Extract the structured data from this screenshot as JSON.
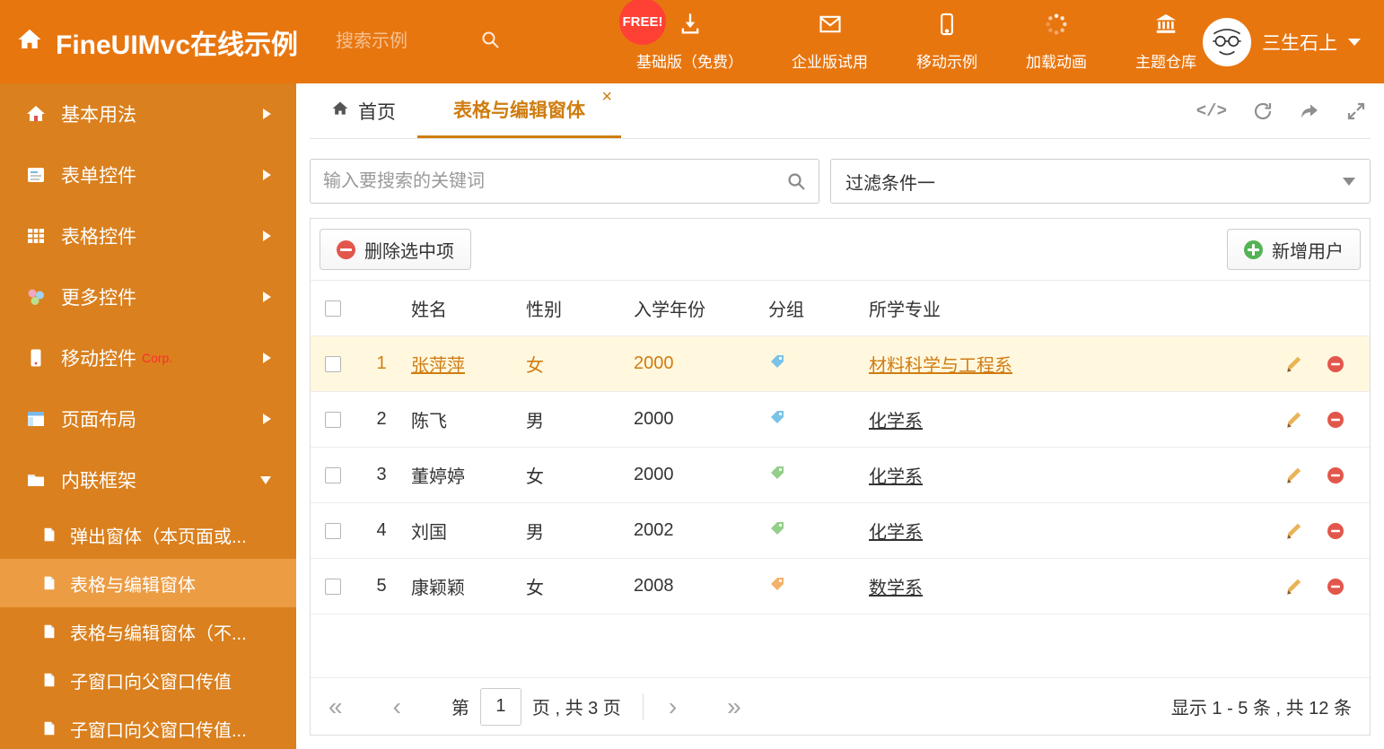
{
  "colors": {
    "header_bg": "#e8760f",
    "sidebar_bg": "#da801e",
    "sidebar_active_bg": "#ec9c43",
    "accent": "#cf7d10",
    "selected_row_bg": "#fff8df",
    "selected_row_text": "#d07c12",
    "delete_red": "#e2574c",
    "add_green": "#54b354",
    "free_badge_red": "#ff4135"
  },
  "header": {
    "title": "FineUIMvc在线示例",
    "search_placeholder": "搜索示例",
    "free_badge": "FREE!",
    "nav": [
      {
        "label": "基础版（免费）",
        "icon": "download-icon"
      },
      {
        "label": "企业版试用",
        "icon": "mail-icon"
      },
      {
        "label": "移动示例",
        "icon": "mobile-icon"
      },
      {
        "label": "加载动画",
        "icon": "spinner-icon"
      },
      {
        "label": "主题仓库",
        "icon": "bank-icon"
      }
    ],
    "user_name": "三生石上"
  },
  "sidebar": {
    "items": [
      {
        "label": "基本用法"
      },
      {
        "label": "表单控件"
      },
      {
        "label": "表格控件"
      },
      {
        "label": "更多控件"
      },
      {
        "label": "移动控件",
        "badge": "Corp."
      },
      {
        "label": "页面布局"
      },
      {
        "label": "内联框架"
      }
    ],
    "subitems": [
      {
        "label": "弹出窗体（本页面或..."
      },
      {
        "label": "表格与编辑窗体"
      },
      {
        "label": "表格与编辑窗体（不..."
      },
      {
        "label": "子窗口向父窗口传值"
      },
      {
        "label": "子窗口向父窗口传值..."
      }
    ]
  },
  "tabs": {
    "home": "首页",
    "active": "表格与编辑窗体",
    "close": "×"
  },
  "icons": {
    "code": "</>",
    "first": "«",
    "prev": "‹",
    "next": "›",
    "last": "»"
  },
  "filterbar": {
    "search_placeholder": "输入要搜索的关键词",
    "filter_selected": "过滤条件一"
  },
  "toolbar": {
    "delete_label": "删除选中项",
    "add_label": "新增用户"
  },
  "table": {
    "columns": {
      "name": "姓名",
      "gender": "性别",
      "year": "入学年份",
      "group": "分组",
      "major": "所学专业"
    },
    "rows": [
      {
        "num": "1",
        "name": "张萍萍",
        "gender": "女",
        "year": "2000",
        "tag_color": "#79c3e8",
        "major": "材料科学与工程系"
      },
      {
        "num": "2",
        "name": "陈飞",
        "gender": "男",
        "year": "2000",
        "tag_color": "#79c3e8",
        "major": "化学系"
      },
      {
        "num": "3",
        "name": "董婷婷",
        "gender": "女",
        "year": "2000",
        "tag_color": "#93cf8a",
        "major": "化学系"
      },
      {
        "num": "4",
        "name": "刘国",
        "gender": "男",
        "year": "2002",
        "tag_color": "#93cf8a",
        "major": "化学系"
      },
      {
        "num": "5",
        "name": "康颖颖",
        "gender": "女",
        "year": "2008",
        "tag_color": "#f3b269",
        "major": "数学系"
      }
    ]
  },
  "pagination": {
    "page_prefix": "第",
    "page_value": "1",
    "page_suffix": "页 , 共 3 页",
    "summary": "显示 1 - 5 条 , 共 12 条"
  }
}
